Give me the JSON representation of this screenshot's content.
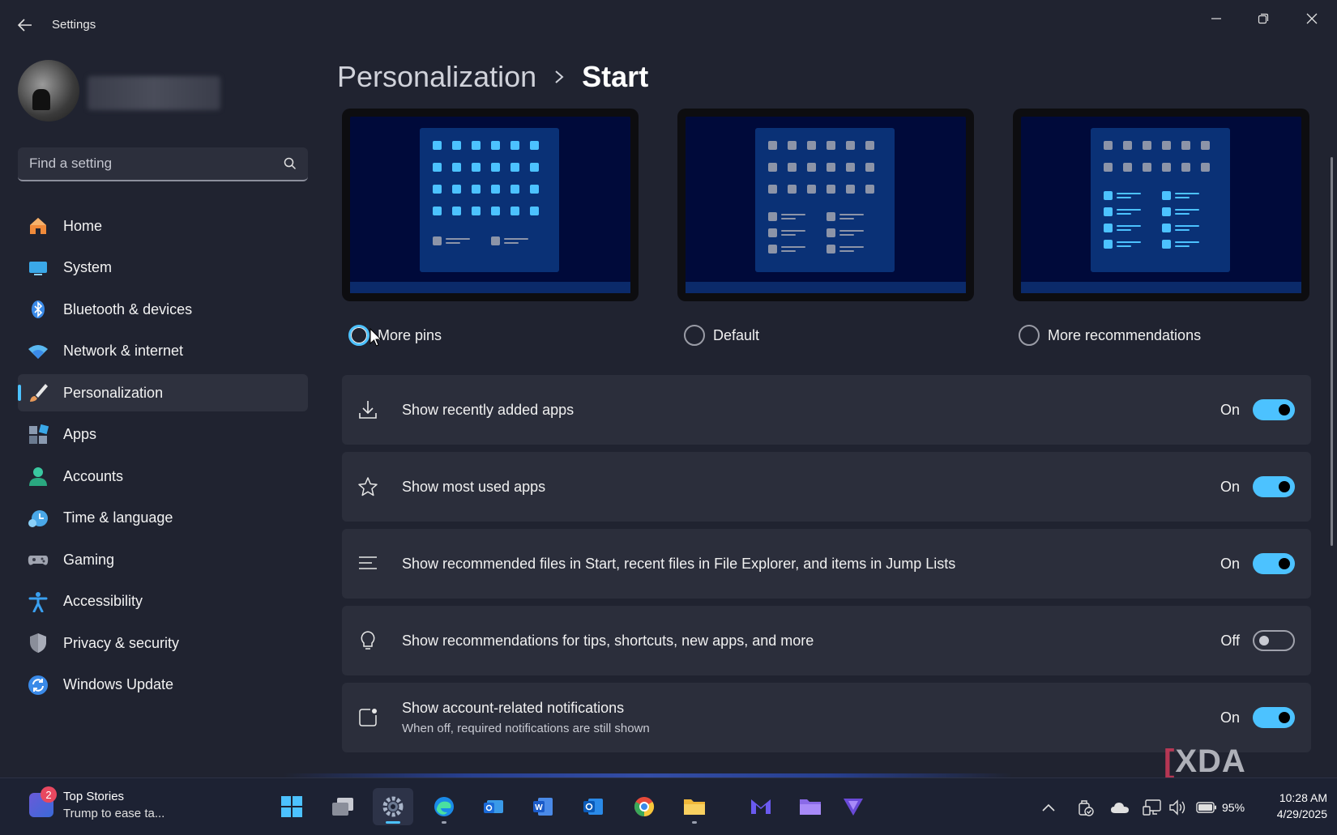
{
  "window": {
    "title": "Settings",
    "back_label": "Back",
    "controls": [
      "minimize",
      "maximize",
      "close"
    ]
  },
  "sidebar": {
    "search_placeholder": "Find a setting",
    "items": [
      {
        "label": "Home",
        "icon": "home-icon",
        "color": "#f08a3a"
      },
      {
        "label": "System",
        "icon": "system-icon",
        "color": "#3aa8e8"
      },
      {
        "label": "Bluetooth & devices",
        "icon": "bluetooth-icon",
        "color": "#3a8ae8"
      },
      {
        "label": "Network & internet",
        "icon": "wifi-icon",
        "color": "#5ab8f0"
      },
      {
        "label": "Personalization",
        "icon": "brush-icon",
        "color": "#e89a5a",
        "active": true
      },
      {
        "label": "Apps",
        "icon": "apps-icon",
        "color": "#8a9ab0"
      },
      {
        "label": "Accounts",
        "icon": "accounts-icon",
        "color": "#3ac8a0"
      },
      {
        "label": "Time & language",
        "icon": "time-language-icon",
        "color": "#4aa8e8"
      },
      {
        "label": "Gaming",
        "icon": "gaming-icon",
        "color": "#a0a4b0"
      },
      {
        "label": "Accessibility",
        "icon": "accessibility-icon",
        "color": "#3aa0f0"
      },
      {
        "label": "Privacy & security",
        "icon": "shield-icon",
        "color": "#8a8e9a"
      },
      {
        "label": "Windows Update",
        "icon": "update-icon",
        "color": "#3a8ae8"
      }
    ]
  },
  "breadcrumb": {
    "parent": "Personalization",
    "current": "Start"
  },
  "layout_options": [
    {
      "label": "More pins",
      "selected": false,
      "focused": true
    },
    {
      "label": "Default",
      "selected": false,
      "focused": false
    },
    {
      "label": "More recommendations",
      "selected": false,
      "focused": false
    }
  ],
  "settings": [
    {
      "label": "Show recently added apps",
      "sublabel": "",
      "state": "On",
      "on": true,
      "icon": "download-icon"
    },
    {
      "label": "Show most used apps",
      "sublabel": "",
      "state": "On",
      "on": true,
      "icon": "star-icon"
    },
    {
      "label": "Show recommended files in Start, recent files in File Explorer, and items in Jump Lists",
      "sublabel": "",
      "state": "On",
      "on": true,
      "icon": "list-icon"
    },
    {
      "label": "Show recommendations for tips, shortcuts, new apps, and more",
      "sublabel": "",
      "state": "Off",
      "on": false,
      "icon": "lightbulb-icon"
    },
    {
      "label": "Show account-related notifications",
      "sublabel": "When off, required notifications are still shown",
      "state": "On",
      "on": true,
      "icon": "notification-icon"
    }
  ],
  "watermark": {
    "bracket": "[",
    "text": "XDA"
  },
  "taskbar": {
    "news": {
      "badge": "2",
      "title": "Top Stories",
      "subtitle": "Trump to ease ta..."
    },
    "apps": [
      "start-icon",
      "task-view-icon",
      "settings-app-icon",
      "edge-icon",
      "outlook-new-icon",
      "word-icon",
      "outlook-icon",
      "chrome-icon",
      "file-explorer-icon",
      "mail-icon",
      "folder-icon",
      "vpn-icon"
    ],
    "tray": {
      "battery": "95%"
    },
    "clock": {
      "time": "10:28 AM",
      "date": "4/29/2025"
    }
  },
  "colors": {
    "accent": "#4cc2ff",
    "background": "#202330",
    "card": "#2b2e3b"
  }
}
